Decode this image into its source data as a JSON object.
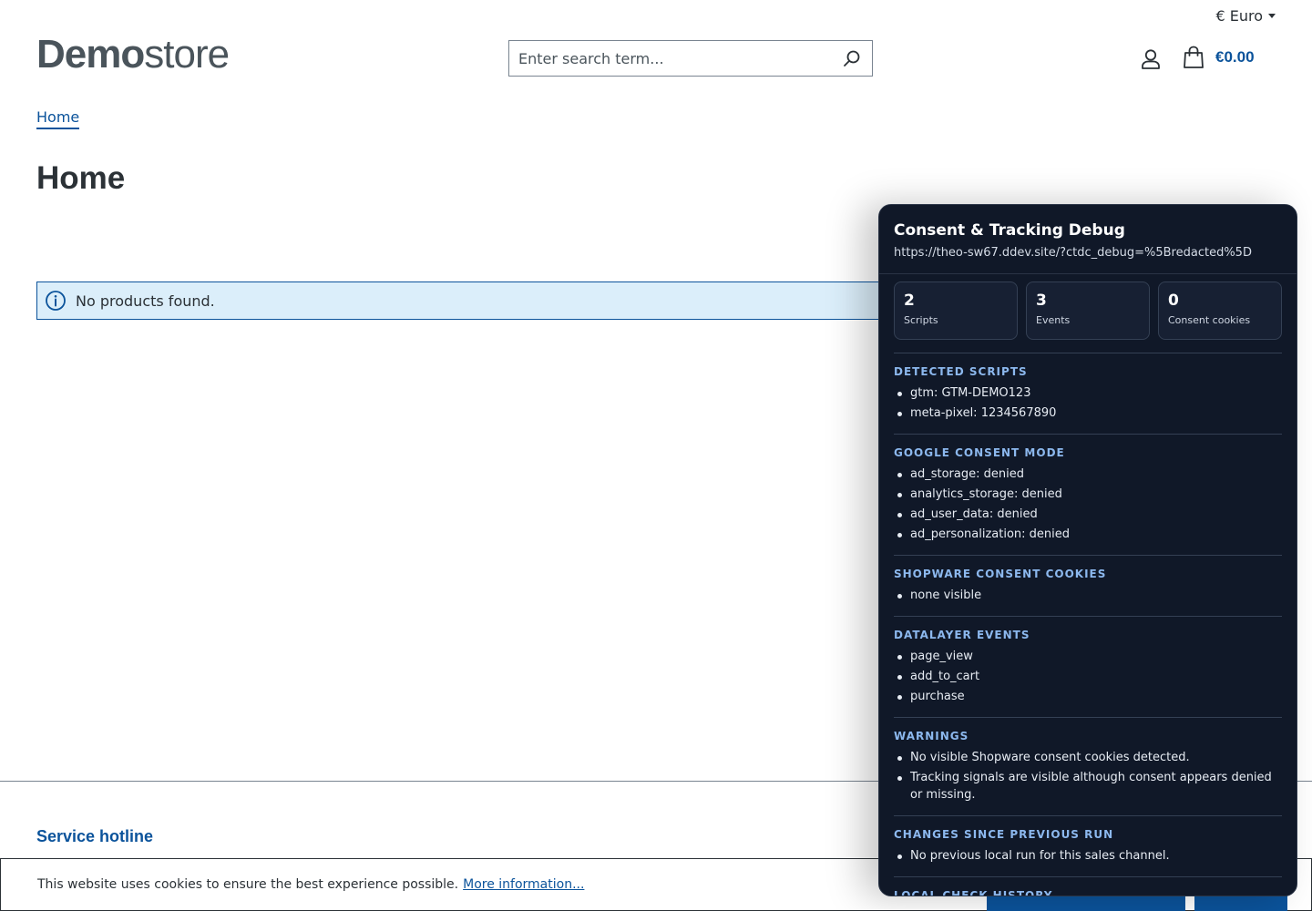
{
  "header": {
    "currency": "€ Euro",
    "logo_bold": "Demo",
    "logo_light": "store",
    "search_placeholder": "Enter search term...",
    "cart_total": "€0.00"
  },
  "breadcrumb": {
    "home": "Home"
  },
  "page_title": "Home",
  "alert": {
    "message": "No products found."
  },
  "footer": {
    "hotline_title": "Service hotline"
  },
  "cookie_bar": {
    "text": "This website uses cookies to ensure the best experience possible.",
    "more_link": "More information..."
  },
  "debug_panel": {
    "title": "Consent & Tracking Debug",
    "url": "https://theo-sw67.ddev.site/?ctdc_debug=%5Bredacted%5D",
    "stats": [
      {
        "value": "2",
        "label": "Scripts"
      },
      {
        "value": "3",
        "label": "Events"
      },
      {
        "value": "0",
        "label": "Consent cookies"
      }
    ],
    "sections": {
      "scripts": {
        "title": "DETECTED SCRIPTS",
        "items": [
          "gtm: GTM-DEMO123",
          "meta-pixel: 1234567890"
        ]
      },
      "consent_mode": {
        "title": "GOOGLE CONSENT MODE",
        "items": [
          "ad_storage: denied",
          "analytics_storage: denied",
          "ad_user_data: denied",
          "ad_personalization: denied"
        ]
      },
      "cookies": {
        "title": "SHOPWARE CONSENT COOKIES",
        "items": [
          "none visible"
        ]
      },
      "events": {
        "title": "DATALAYER EVENTS",
        "items": [
          "page_view",
          "add_to_cart",
          "purchase"
        ]
      },
      "warnings": {
        "title": "WARNINGS",
        "items": [
          "No visible Shopware consent cookies detected.",
          "Tracking signals are visible although consent appears denied or missing."
        ]
      },
      "changes": {
        "title": "CHANGES SINCE PREVIOUS RUN",
        "items": [
          "No previous local run for this sales channel."
        ]
      },
      "history": {
        "title": "LOCAL CHECK HISTORY"
      }
    }
  },
  "colors": {
    "brand": "#0b539b",
    "panel_bg": "#101828",
    "section_heading": "#8cb8ee",
    "alert_bg": "#dbeefa"
  }
}
